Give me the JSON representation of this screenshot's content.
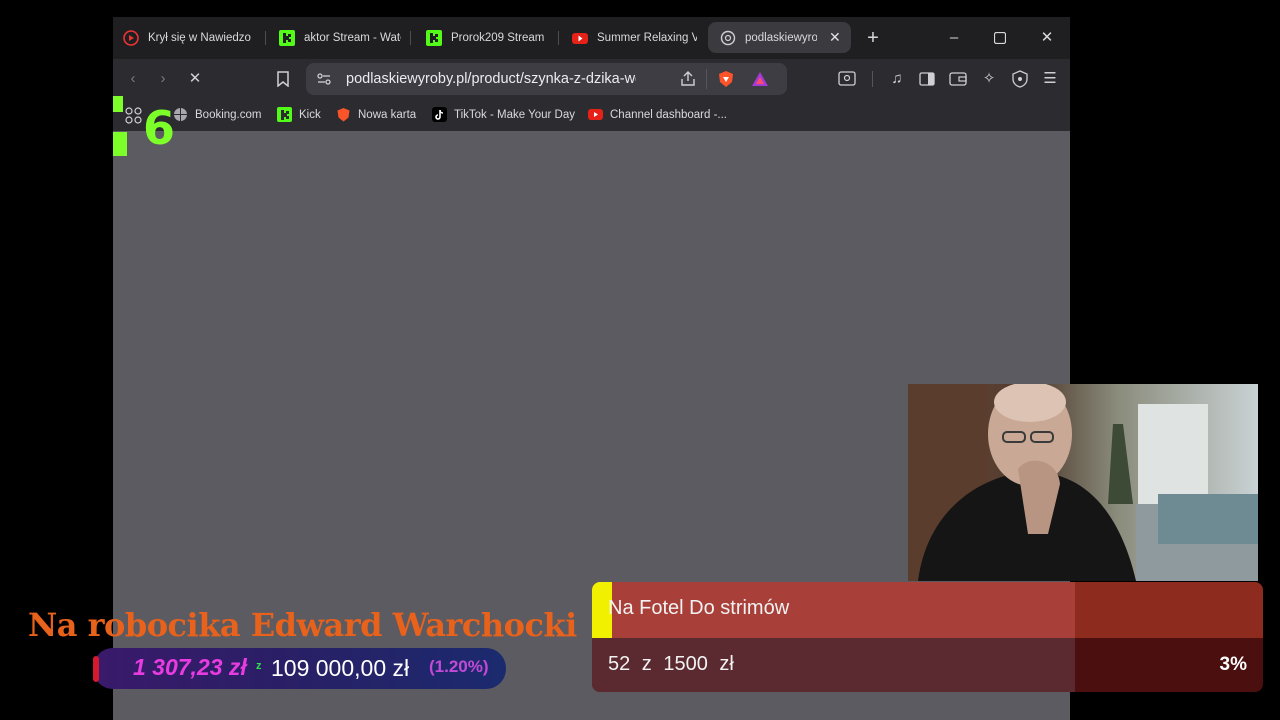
{
  "browser": {
    "tabs": [
      {
        "label": "Krył się w Nawiedzo",
        "icon": "youtube-circle-icon"
      },
      {
        "label": "aktor Stream - Watc",
        "icon": "kick-icon"
      },
      {
        "label": "Prorok209 Stream -",
        "icon": "kick-icon"
      },
      {
        "label": "Summer Relaxing V",
        "icon": "youtube-icon"
      },
      {
        "label": "podlaskiewyro",
        "icon": "globe-icon",
        "active": true
      }
    ],
    "url": "podlaskiewyroby.pl/product/szynka-z-dzika-wedz...",
    "bookmarks": [
      {
        "label": "Booking.com",
        "icon": "globe-icon"
      },
      {
        "label": "Kick",
        "icon": "kick-icon"
      },
      {
        "label": "Nowa karta",
        "icon": "brave-icon"
      },
      {
        "label": "TikTok - Make Your Day",
        "icon": "tiktok-icon"
      },
      {
        "label": "Channel dashboard -...",
        "icon": "youtube-icon"
      }
    ]
  },
  "overlay": {
    "counter_digit": "6",
    "title": "Na robocika Edward Warchocki",
    "collected": "1 307,23 zł",
    "of_label": "z",
    "target": "109 000,00 zł",
    "percent": "(1.20%)"
  },
  "goal": {
    "title": "Na Fotel Do strimów",
    "progress_text": "52 z 1500 zł",
    "percent_label": "3%",
    "fill_fraction": 0.72
  },
  "colors": {
    "title_orange": "#e8621c",
    "kick_green": "#53fc18",
    "goal_yellow": "#f0f000",
    "amount_magenta": "#e83be0"
  }
}
